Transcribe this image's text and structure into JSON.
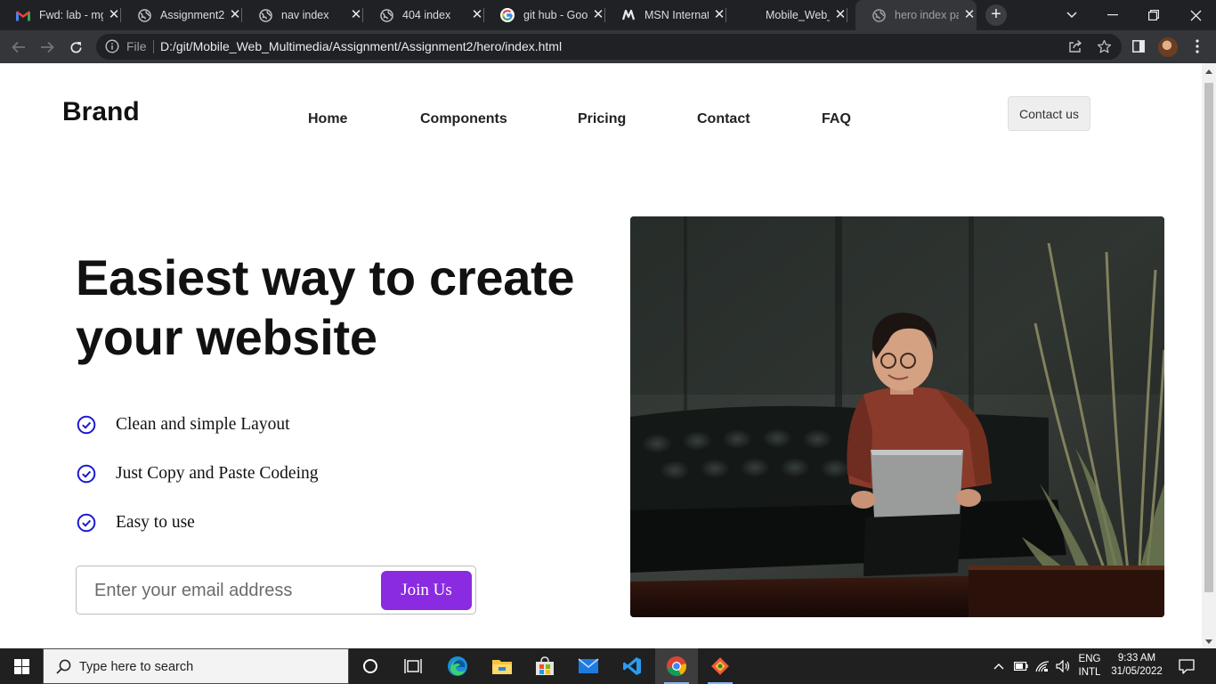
{
  "browser": {
    "tabs": [
      {
        "title": "Fwd: lab - mg",
        "icon": "gmail-icon",
        "active": false
      },
      {
        "title": "Assignment2",
        "icon": "globe-icon",
        "active": false
      },
      {
        "title": "nav index",
        "icon": "globe-icon",
        "active": false
      },
      {
        "title": "404 index",
        "icon": "globe-icon",
        "active": false
      },
      {
        "title": "git hub - Goo",
        "icon": "google-icon",
        "active": false
      },
      {
        "title": "MSN Internat",
        "icon": "msn-icon",
        "active": false
      },
      {
        "title": "Mobile_Web_",
        "icon": "blank-icon",
        "active": false
      },
      {
        "title": "hero index pa",
        "icon": "globe-icon",
        "active": true
      }
    ],
    "address_bar": {
      "scheme_label": "File",
      "url": "D:/git/Mobile_Web_Multimedia/Assignment/Assignment2/hero/index.html"
    }
  },
  "page": {
    "brand": "Brand",
    "nav": [
      "Home",
      "Components",
      "Pricing",
      "Contact",
      "FAQ"
    ],
    "contact_button": "Contact us",
    "hero": {
      "title_line1": "Easiest way to create",
      "title_line2": "your website",
      "features": [
        "Clean and simple Layout",
        "Just Copy and Paste Codeing",
        "Easy to use"
      ],
      "email_placeholder": "Enter your email address",
      "join_button": "Join Us"
    },
    "accent_color": "#8a2be2",
    "check_color": "#1a1ad0"
  },
  "taskbar": {
    "search_placeholder": "Type here to search",
    "language": "ENG",
    "layout": "INTL",
    "time": "9:33 AM",
    "date": "31/05/2022"
  }
}
